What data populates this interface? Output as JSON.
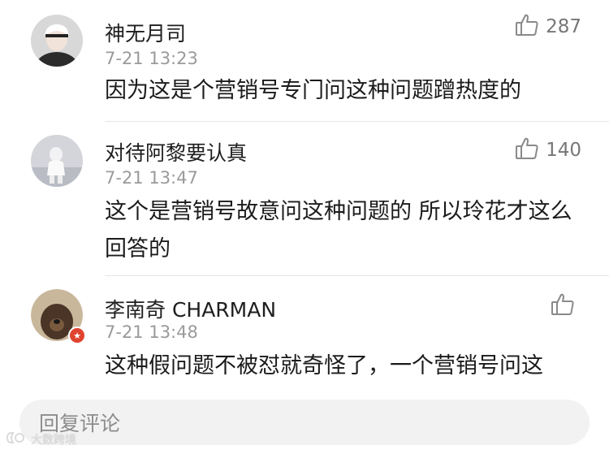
{
  "comments": [
    {
      "username": "神无月司",
      "timestamp": "7-21 13:23",
      "text": "因为这是个营销号专门问这种问题蹭热度的",
      "likes": "287"
    },
    {
      "username": "对待阿黎要认真",
      "timestamp": "7-21 13:47",
      "text": "这个是营销号故意问这种问题的 所以玲花才这么回答的",
      "likes": "140"
    },
    {
      "username": "李南奇 CHARMAN",
      "timestamp": "7-21 13:48",
      "text": "这种假问题不被怼就奇怪了，一个营销号问这",
      "likes": ""
    }
  ],
  "reply_bar": {
    "placeholder": "回复评论"
  },
  "watermark": {
    "text": "大数跨境"
  },
  "colors": {
    "text_primary": "#1b1b1b",
    "text_secondary": "#9a9a9a",
    "like_icon": "#8a8a8a",
    "input_bg": "#f2f2f2"
  },
  "icons": {
    "like": "thumbs-up-icon",
    "badge": "red-star-badge-icon"
  }
}
